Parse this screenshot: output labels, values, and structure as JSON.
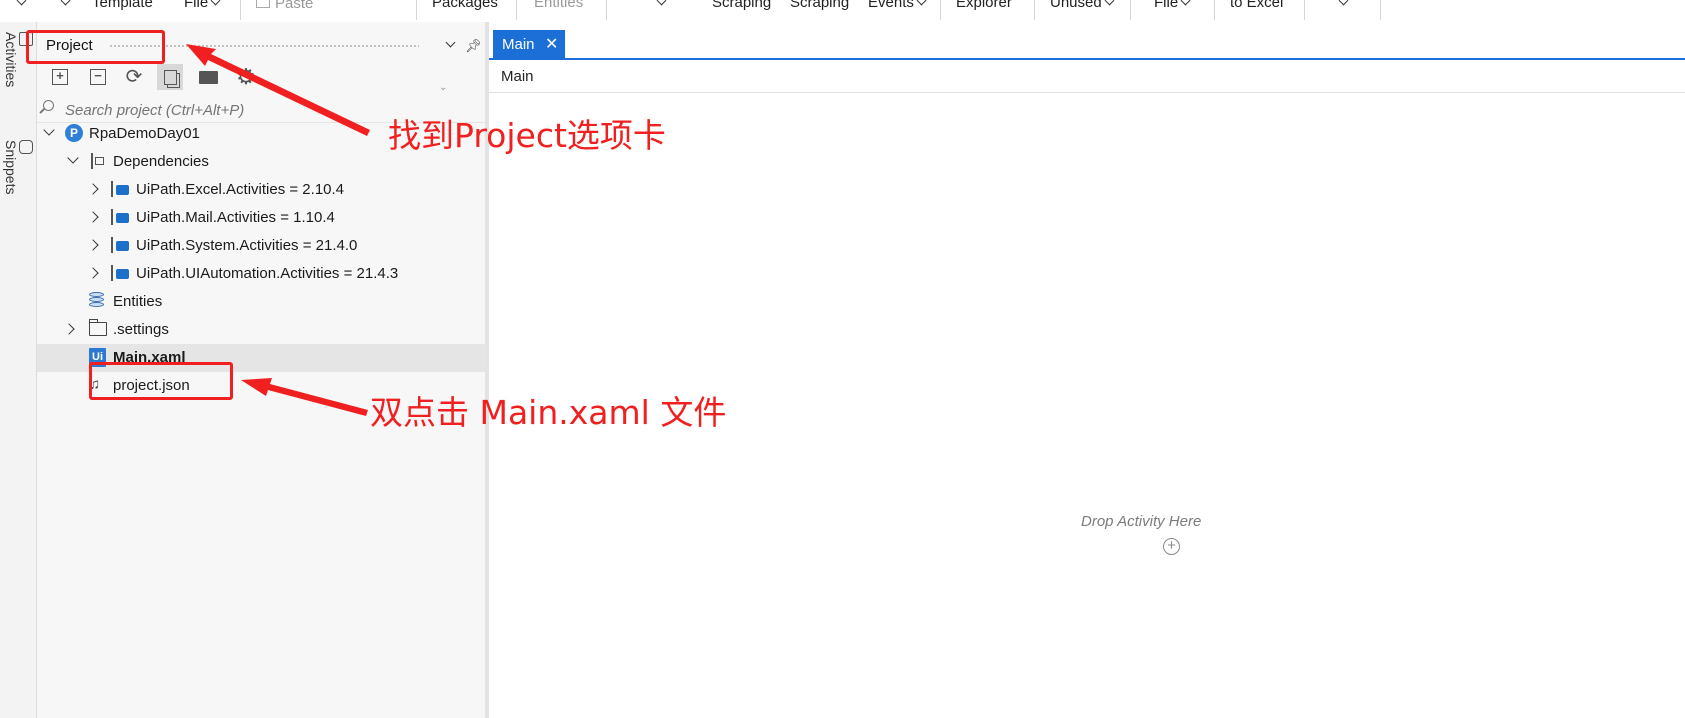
{
  "ribbon": {
    "items": [
      {
        "label": "",
        "dropdown": true
      },
      {
        "label": "",
        "dropdown": true
      },
      {
        "label": "Template",
        "dropdown": false
      },
      {
        "label": "File",
        "dropdown": true
      },
      {
        "label": "Paste",
        "dropdown": false,
        "disabled": true
      },
      {
        "label": "Packages",
        "dropdown": false
      },
      {
        "label": "Entities",
        "dropdown": false,
        "disabled": true
      },
      {
        "label": "",
        "dropdown": true
      },
      {
        "label": "Scraping",
        "dropdown": false
      },
      {
        "label": "Scraping",
        "dropdown": false
      },
      {
        "label": "Events",
        "dropdown": true
      },
      {
        "label": "Explorer",
        "dropdown": false
      },
      {
        "label": "Unused",
        "dropdown": true
      },
      {
        "label": "File",
        "dropdown": true
      },
      {
        "label": "to Excel",
        "dropdown": false
      },
      {
        "label": "",
        "dropdown": true
      }
    ]
  },
  "rail": {
    "tabs": [
      {
        "label": "Activities",
        "icon": "activities-icon"
      },
      {
        "label": "Snippets",
        "icon": "snippets-icon"
      }
    ]
  },
  "project_panel": {
    "title": "Project",
    "search_placeholder": "Search project (Ctrl+Alt+P)",
    "toolbar": [
      "expand-all-icon",
      "collapse-all-icon",
      "refresh-icon",
      "show-all-files-icon",
      "open-folder-icon",
      "settings-icon"
    ],
    "tree": {
      "project": "RpaDemoDay01",
      "dependencies_label": "Dependencies",
      "packages": [
        "UiPath.Excel.Activities = 2.10.4",
        "UiPath.Mail.Activities = 1.10.4",
        "UiPath.System.Activities = 21.4.0",
        "UiPath.UIAutomation.Activities = 21.4.3"
      ],
      "entities": "Entities",
      "settings_folder": ".settings",
      "main_file": "Main.xaml",
      "project_json": "project.json"
    }
  },
  "designer": {
    "tab_label": "Main",
    "breadcrumb": "Main",
    "drop_hint": "Drop Activity Here"
  },
  "annotations": {
    "project_tab_note": "找到Project选项卡",
    "main_file_note": "双点击 Main.xaml 文件",
    "color": "#f02020"
  },
  "colors": {
    "accent": "#1c6fd6",
    "selection": "#e5e5e5"
  }
}
